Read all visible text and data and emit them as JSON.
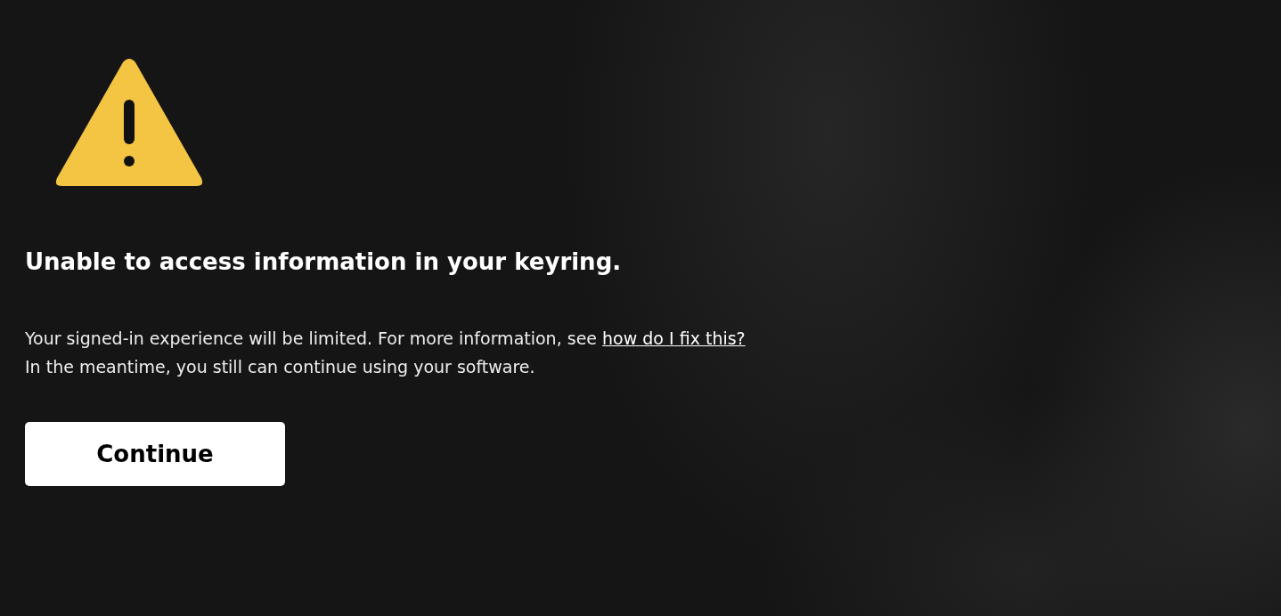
{
  "alert": {
    "title": "Unable to access information in your keyring.",
    "message": {
      "before_link": "Your signed-in experience will be limited. For more information, see ",
      "link": "how do I fix this?",
      "after_link": "In the meantime, you still can continue using your software."
    },
    "buttons": [
      "Continue"
    ]
  }
}
